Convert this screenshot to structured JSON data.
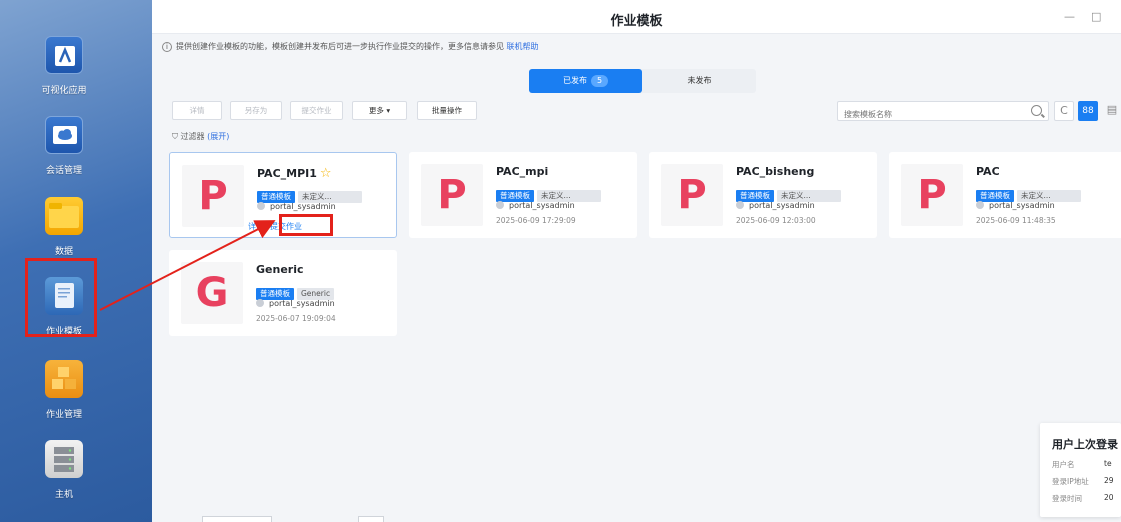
{
  "desktop": {
    "apps": [
      {
        "label": "可视化应用",
        "icon": "visual-app-icon"
      },
      {
        "label": "会话管理",
        "icon": "cloud-session-icon"
      },
      {
        "label": "数据",
        "icon": "folder-icon"
      },
      {
        "label": "作业模板",
        "icon": "document-template-icon"
      },
      {
        "label": "作业管理",
        "icon": "boxes-icon"
      },
      {
        "label": "主机",
        "icon": "server-icon"
      }
    ]
  },
  "window": {
    "title": "作业模板",
    "minimize": "—",
    "maximize": "□"
  },
  "info": {
    "icon": "i",
    "text": "提供创建作业模板的功能，模板创建并发布后可进一步执行作业提交的操作，更多信息请参见",
    "link": "联机帮助"
  },
  "tabs": {
    "published_label": "已发布",
    "published_count": "5",
    "unpublished_label": "未发布"
  },
  "toolbar": {
    "details": "详情",
    "save_as": "另存为",
    "submit_job": "提交作业",
    "more": "更多",
    "more_caret": "▾",
    "batch": "批量操作"
  },
  "search": {
    "placeholder": "搜索模板名称"
  },
  "view_buttons": {
    "refresh": "C",
    "grid": "88",
    "list": "▤"
  },
  "filter": {
    "icon": "⛉",
    "label": "过滤器",
    "expand": "(展开)"
  },
  "cards": [
    {
      "initial": "P",
      "name": "PAC_MPI1",
      "star": "☆",
      "tag_primary": "普通模板",
      "tag_secondary": "未定义...",
      "owner": "portal_sysadmin",
      "action_detail": "详情",
      "action_submit": "提交作业"
    },
    {
      "initial": "P",
      "name": "PAC_mpi",
      "tag_primary": "普通模板",
      "tag_secondary": "未定义...",
      "owner": "portal_sysadmin",
      "time": "2025-06-09 17:29:09"
    },
    {
      "initial": "P",
      "name": "PAC_bisheng",
      "tag_primary": "普通模板",
      "tag_secondary": "未定义...",
      "owner": "portal_sysadmin",
      "time": "2025-06-09 12:03:00"
    },
    {
      "initial": "P",
      "name": "PAC",
      "tag_primary": "普通模板",
      "tag_secondary": "未定义...",
      "owner": "portal_sysadmin",
      "time": "2025-06-09 11:48:35"
    },
    {
      "initial": "G",
      "name": "Generic",
      "tag_primary": "普通模板",
      "tag_secondary": "Generic",
      "owner": "portal_sysadmin",
      "time": "2025-06-07 19:09:04"
    }
  ],
  "login_popup": {
    "title": "用户上次登录",
    "username_label": "用户名",
    "username_value": "te",
    "ip_label": "登录IP地址",
    "ip_value": "29",
    "time_label": "登录时间",
    "time_value": "20"
  },
  "colors": {
    "accent": "#1a7ef2",
    "highlight_red": "#e3221b",
    "tile_letter": "#e8415f",
    "star": "#f5b300"
  }
}
